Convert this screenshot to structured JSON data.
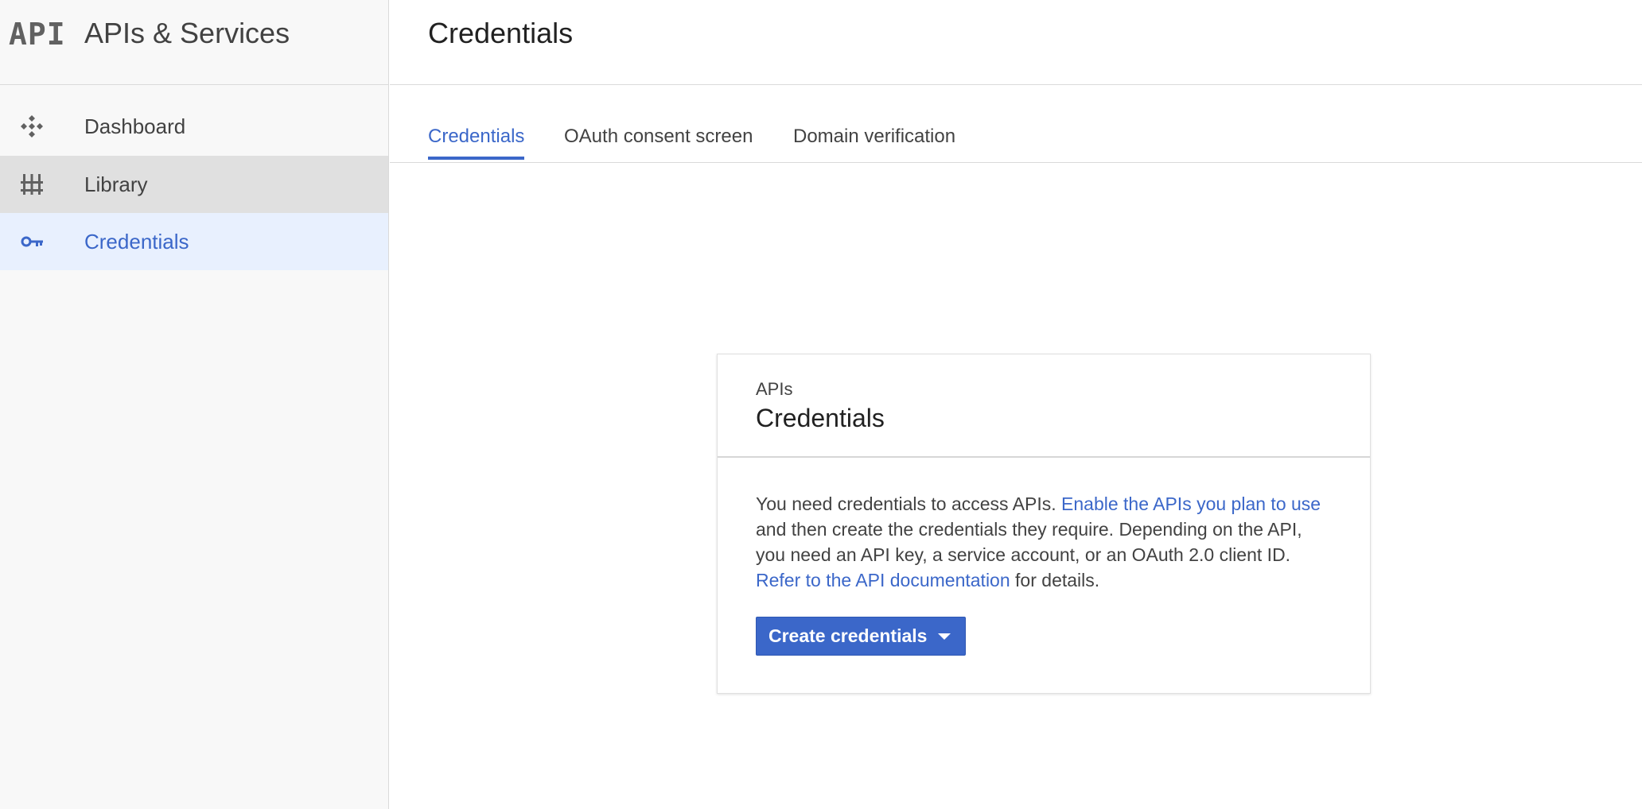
{
  "sidebar": {
    "logo_text": "API",
    "product_title": "APIs & Services",
    "items": [
      {
        "label": "Dashboard",
        "icon": "dashboard-icon"
      },
      {
        "label": "Library",
        "icon": "library-icon"
      },
      {
        "label": "Credentials",
        "icon": "key-icon",
        "active": true
      }
    ]
  },
  "header": {
    "title": "Credentials"
  },
  "tabs": [
    {
      "label": "Credentials",
      "active": true
    },
    {
      "label": "OAuth consent screen"
    },
    {
      "label": "Domain verification"
    }
  ],
  "card": {
    "kicker": "APIs",
    "title": "Credentials",
    "text_1": "You need credentials to access APIs. ",
    "link_1": "Enable the APIs you plan to use",
    "text_2": " and then create the credentials they require. Depending on the API, you need an API key, a service account, or an OAuth 2.0 client ID. ",
    "link_2": "Refer to the API documentation",
    "text_3": " for details.",
    "button_label": "Create credentials",
    "button_icon": "caret-down-icon"
  },
  "colors": {
    "accent": "#3b67c9",
    "active_nav_bg": "#e8f0fe",
    "hover_nav_bg": "#e0e0e0",
    "sidebar_bg": "#f8f8f8"
  }
}
